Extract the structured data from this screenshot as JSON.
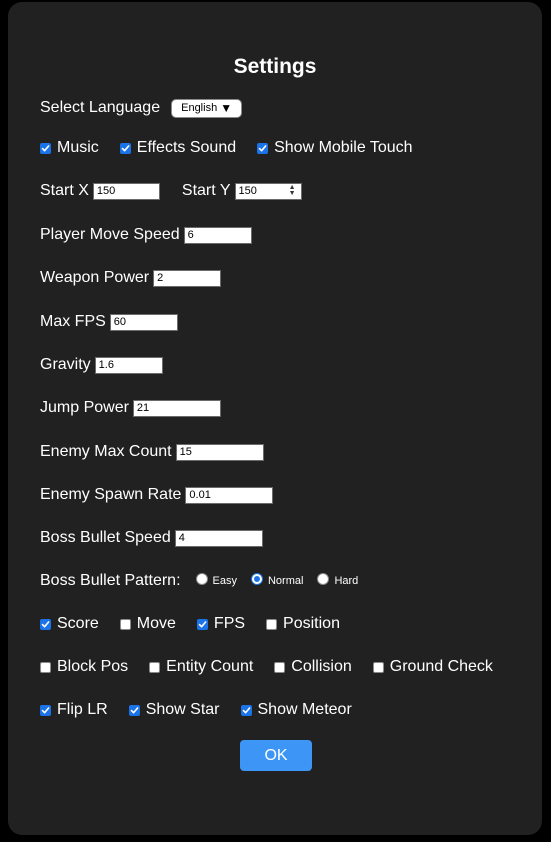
{
  "title": "Settings",
  "language": {
    "label": "Select Language",
    "selected": "English"
  },
  "sound": {
    "music": {
      "label": "Music",
      "checked": true
    },
    "effects": {
      "label": "Effects Sound",
      "checked": true
    },
    "mobile_touch": {
      "label": "Show Mobile Touch",
      "checked": true
    }
  },
  "start": {
    "x_label": "Start X",
    "x_value": "150",
    "y_label": "Start Y",
    "y_value": "150"
  },
  "fields": {
    "player_move_speed": {
      "label": "Player Move Speed",
      "value": "6"
    },
    "weapon_power": {
      "label": "Weapon Power",
      "value": "2"
    },
    "max_fps": {
      "label": "Max FPS",
      "value": "60"
    },
    "gravity": {
      "label": "Gravity",
      "value": "1.6"
    },
    "jump_power": {
      "label": "Jump Power",
      "value": "21"
    },
    "enemy_max_count": {
      "label": "Enemy Max Count",
      "value": "15"
    },
    "enemy_spawn_rate": {
      "label": "Enemy Spawn Rate",
      "value": "0.01"
    },
    "boss_bullet_speed": {
      "label": "Boss Bullet Speed",
      "value": "4"
    }
  },
  "boss_pattern": {
    "label": "Boss Bullet Pattern:",
    "options": [
      "Easy",
      "Normal",
      "Hard"
    ],
    "selected": "Normal"
  },
  "debug_row1": [
    {
      "label": "Score",
      "checked": true
    },
    {
      "label": "Move",
      "checked": false
    },
    {
      "label": "FPS",
      "checked": true
    },
    {
      "label": "Position",
      "checked": false
    }
  ],
  "debug_row2": [
    {
      "label": "Block Pos",
      "checked": false
    },
    {
      "label": "Entity Count",
      "checked": false
    },
    {
      "label": "Collision",
      "checked": false
    },
    {
      "label": "Ground Check",
      "checked": false
    }
  ],
  "display_row": [
    {
      "label": "Flip LR",
      "checked": true
    },
    {
      "label": "Show Star",
      "checked": true
    },
    {
      "label": "Show Meteor",
      "checked": true
    }
  ],
  "ok_label": "OK",
  "colors": {
    "accent": "#1a73e8",
    "ok_button": "#3d96f5",
    "panel": "#212121"
  }
}
